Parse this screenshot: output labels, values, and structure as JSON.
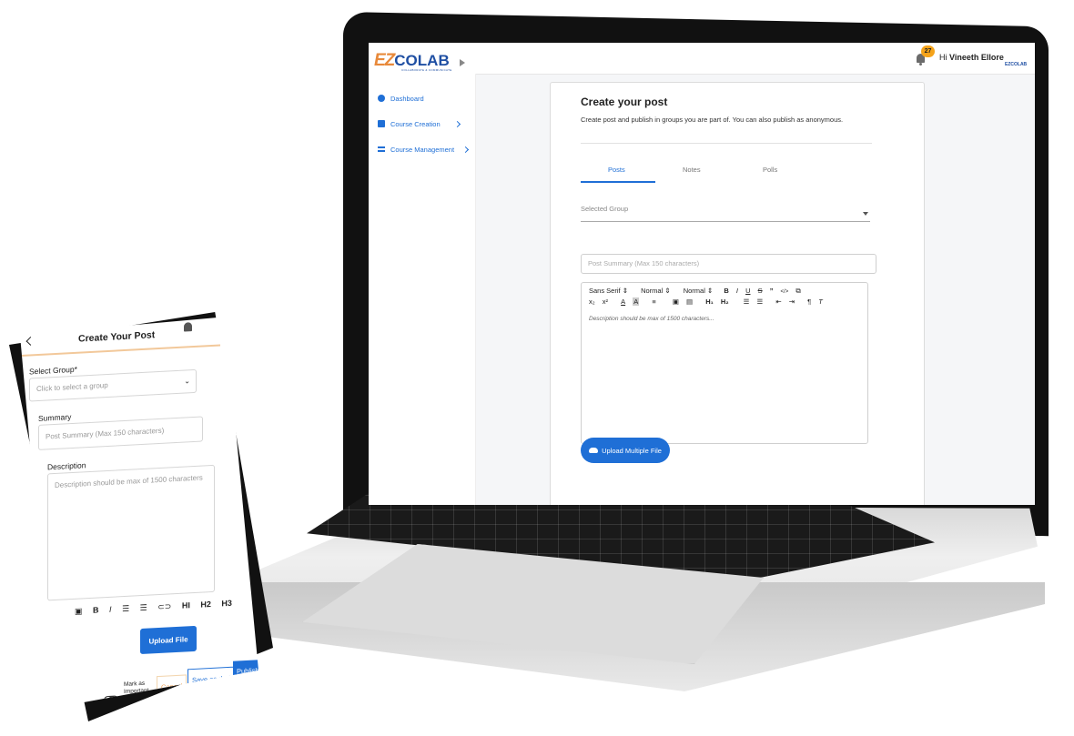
{
  "laptop": {
    "logo": {
      "ez": "EZ",
      "colab": "COLAB",
      "tagline": "COLLABORATE & COMMUNICATE"
    },
    "header": {
      "notification_count": "27",
      "greeting": "Hi",
      "user_name": "Vineeth Ellore",
      "mini_logo": "EZCOLAB"
    },
    "sidebar": {
      "items": [
        {
          "label": "Dashboard",
          "icon": "dashboard-icon"
        },
        {
          "label": "Course Creation",
          "icon": "book-icon"
        },
        {
          "label": "Course Management",
          "icon": "list-icon"
        }
      ]
    },
    "main": {
      "title": "Create your post",
      "subtitle": "Create post and publish in groups you are part of. You can also publish as anonymous.",
      "tabs": [
        {
          "label": "Posts",
          "active": true
        },
        {
          "label": "Notes"
        },
        {
          "label": "Polls"
        }
      ],
      "group_select": {
        "placeholder": "Selected Group"
      },
      "summary": {
        "placeholder": "Post Summary (Max 150 characters)"
      },
      "editor": {
        "font_family": "Sans Serif",
        "size_1": "Normal",
        "size_2": "Normal",
        "toolbar_row1": [
          "B",
          "I",
          "U",
          "S",
          "”",
          "</>",
          "⧉"
        ],
        "subscript": "x₂",
        "superscript": "x²",
        "h1": "H₁",
        "h2": "H₂",
        "placeholder": "Description should be max of 1500 characters..."
      },
      "upload_button": "Upload Multiple File"
    }
  },
  "phone": {
    "title": "Create Your Post",
    "select_group_label": "Select Group*",
    "select_group_placeholder": "Click to select a group",
    "summary_label": "Summary",
    "summary_placeholder": "Post Summary (Max 150 characters)",
    "description_label": "Description",
    "description_placeholder": "Description should be max of 1500 characters",
    "toolbar": {
      "bold": "B",
      "italic": "I",
      "h1": "HI",
      "h2": "H2",
      "h3": "H3"
    },
    "upload_button": "Upload File",
    "mark_important": "Mark as Important",
    "cancel": "Cancel",
    "save_draft": "Save as draft",
    "publish": "Publish"
  }
}
